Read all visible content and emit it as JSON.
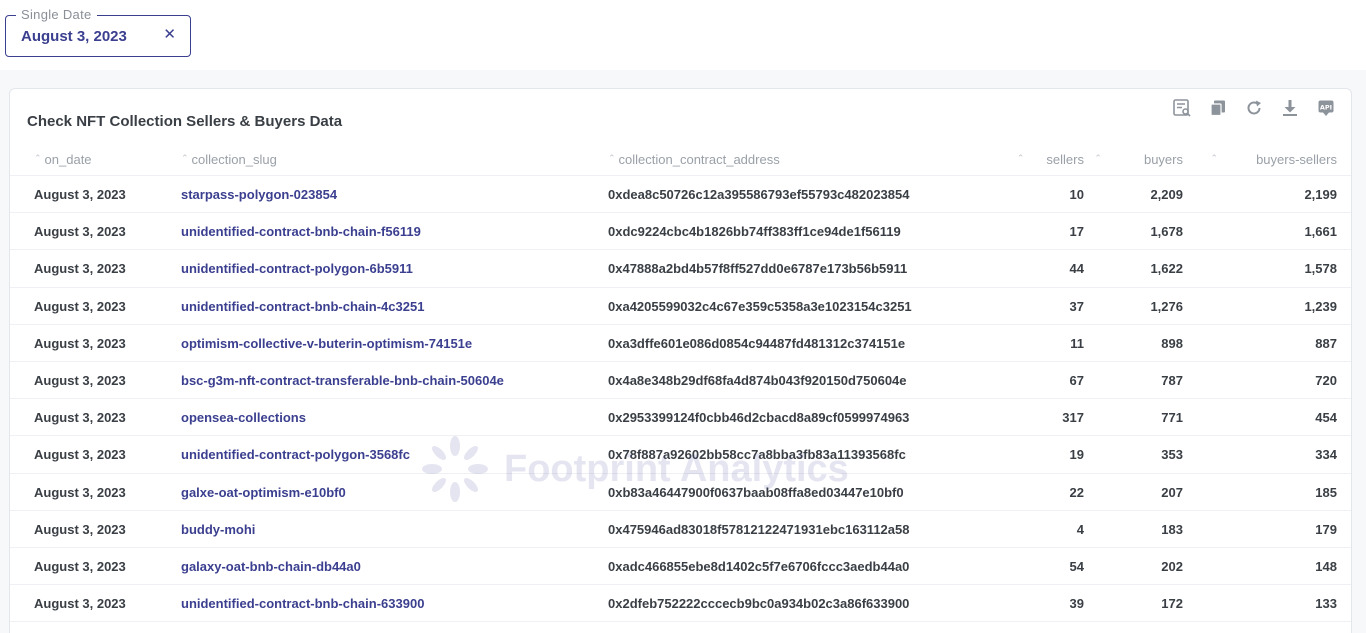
{
  "filter": {
    "legend": "Single Date",
    "value": "August 3, 2023",
    "clear_icon": "close-icon"
  },
  "card": {
    "title": "Check NFT Collection Sellers & Buyers Data",
    "toolbar": [
      "table-query-icon",
      "copy-icon",
      "refresh-icon",
      "download-icon",
      "api-icon"
    ]
  },
  "watermark": {
    "text": "Footprint Analytics"
  },
  "table": {
    "columns": [
      "on_date",
      "collection_slug",
      "collection_contract_address",
      "sellers",
      "buyers",
      "buyers-sellers"
    ],
    "rows": [
      [
        "August 3, 2023",
        "starpass-polygon-023854",
        "0xdea8c50726c12a395586793ef55793c482023854",
        "10",
        "2,209",
        "2,199"
      ],
      [
        "August 3, 2023",
        "unidentified-contract-bnb-chain-f56119",
        "0xdc9224cbc4b1826bb74ff383ff1ce94de1f56119",
        "17",
        "1,678",
        "1,661"
      ],
      [
        "August 3, 2023",
        "unidentified-contract-polygon-6b5911",
        "0x47888a2bd4b57f8ff527dd0e6787e173b56b5911",
        "44",
        "1,622",
        "1,578"
      ],
      [
        "August 3, 2023",
        "unidentified-contract-bnb-chain-4c3251",
        "0xa4205599032c4c67e359c5358a3e1023154c3251",
        "37",
        "1,276",
        "1,239"
      ],
      [
        "August 3, 2023",
        "optimism-collective-v-buterin-optimism-74151e",
        "0xa3dffe601e086d0854c94487fd481312c374151e",
        "11",
        "898",
        "887"
      ],
      [
        "August 3, 2023",
        "bsc-g3m-nft-contract-transferable-bnb-chain-50604e",
        "0x4a8e348b29df68fa4d874b043f920150d750604e",
        "67",
        "787",
        "720"
      ],
      [
        "August 3, 2023",
        "opensea-collections",
        "0x2953399124f0cbb46d2cbacd8a89cf0599974963",
        "317",
        "771",
        "454"
      ],
      [
        "August 3, 2023",
        "unidentified-contract-polygon-3568fc",
        "0x78f887a92602bb58cc7a8bba3fb83a11393568fc",
        "19",
        "353",
        "334"
      ],
      [
        "August 3, 2023",
        "galxe-oat-optimism-e10bf0",
        "0xb83a46447900f0637baab08ffa8ed03447e10bf0",
        "22",
        "207",
        "185"
      ],
      [
        "August 3, 2023",
        "buddy-mohi",
        "0x475946ad83018f57812122471931ebc163112a58",
        "4",
        "183",
        "179"
      ],
      [
        "August 3, 2023",
        "galaxy-oat-bnb-chain-db44a0",
        "0xadc466855ebe8d1402c5f7e6706fccc3aedb44a0",
        "54",
        "202",
        "148"
      ],
      [
        "August 3, 2023",
        "unidentified-contract-bnb-chain-633900",
        "0x2dfeb752222cccecb9bc0a934b02c3a86f633900",
        "39",
        "172",
        "133"
      ]
    ]
  }
}
